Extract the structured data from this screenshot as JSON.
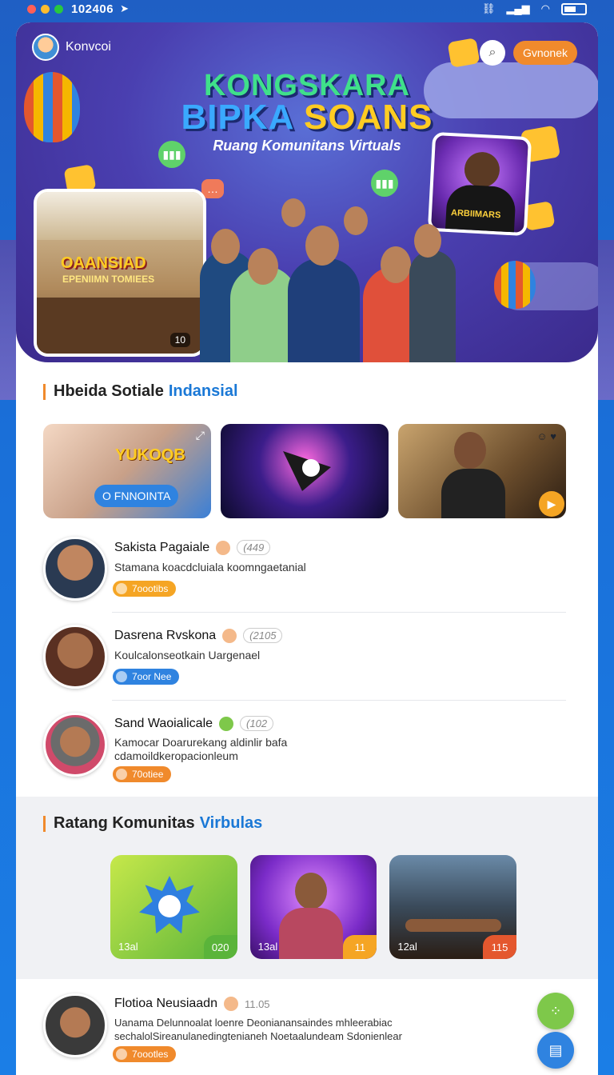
{
  "status_bar": {
    "time": "102406"
  },
  "hero": {
    "user_name": "Konvcoi",
    "action_pill": "Gvnonek",
    "title_line1": "KONGSKARA",
    "title_line2a": "BIPKA ",
    "title_line2b": "SOANS",
    "subtitle": "Ruang Komunitans Virtuals",
    "left_photo_sign": "OAANSIAD",
    "left_photo_sign2": "EPENIIMN TOMIEES",
    "left_photo_badge": "10",
    "right_photo_sticker": "ARBIIMARS"
  },
  "section1": {
    "title": "Hbeida Sotiale",
    "title_highlight": "Indansial",
    "media": [
      {
        "overlay_title": "YUKOQB",
        "overlay_label": "O FNNOINTA"
      },
      {},
      {}
    ]
  },
  "posts": [
    {
      "name": "Sakista Pagaiale",
      "count": "(449",
      "desc": "Stamana koacdcluiala koomngaetanial",
      "tag": "7oootibs",
      "tag_color": "#f5a524"
    },
    {
      "name": "Dasrena Rvskona",
      "count": "(2105",
      "desc": "Koulcalonseotkain Uargenael",
      "tag": "7oor Nee",
      "tag_color": "#2f83e0"
    },
    {
      "name": "Sand Waoialicale",
      "count": "(102",
      "desc": "Kamocar Doarurekang aldinlir bafa cdamoildkeropacionleum",
      "tag": "70otiee",
      "tag_color": "#f08a2c"
    }
  ],
  "section2": {
    "title": "Ratang Komunitas",
    "title_highlight": "Virbulas",
    "tiles": [
      {
        "left": "13al",
        "right": "020"
      },
      {
        "left": "13al",
        "right": "11"
      },
      {
        "left": "12al",
        "right": "115"
      }
    ]
  },
  "bottom_post": {
    "name": "Flotioa Neusiaadn",
    "count": "11.05",
    "desc": "Uanama Delunnoalat loenre Deonianansaindes mhleerabiac sechalolSireanulanedingtenianeh Noetaalundeam Sdonienlear",
    "tag": "7oootles",
    "tag_color": "#f08a2c"
  },
  "colors": {
    "accent_orange": "#f08a2c",
    "accent_blue": "#1a78d6",
    "fab_green": "#7ec84a",
    "fab_blue": "#2f83e0"
  }
}
